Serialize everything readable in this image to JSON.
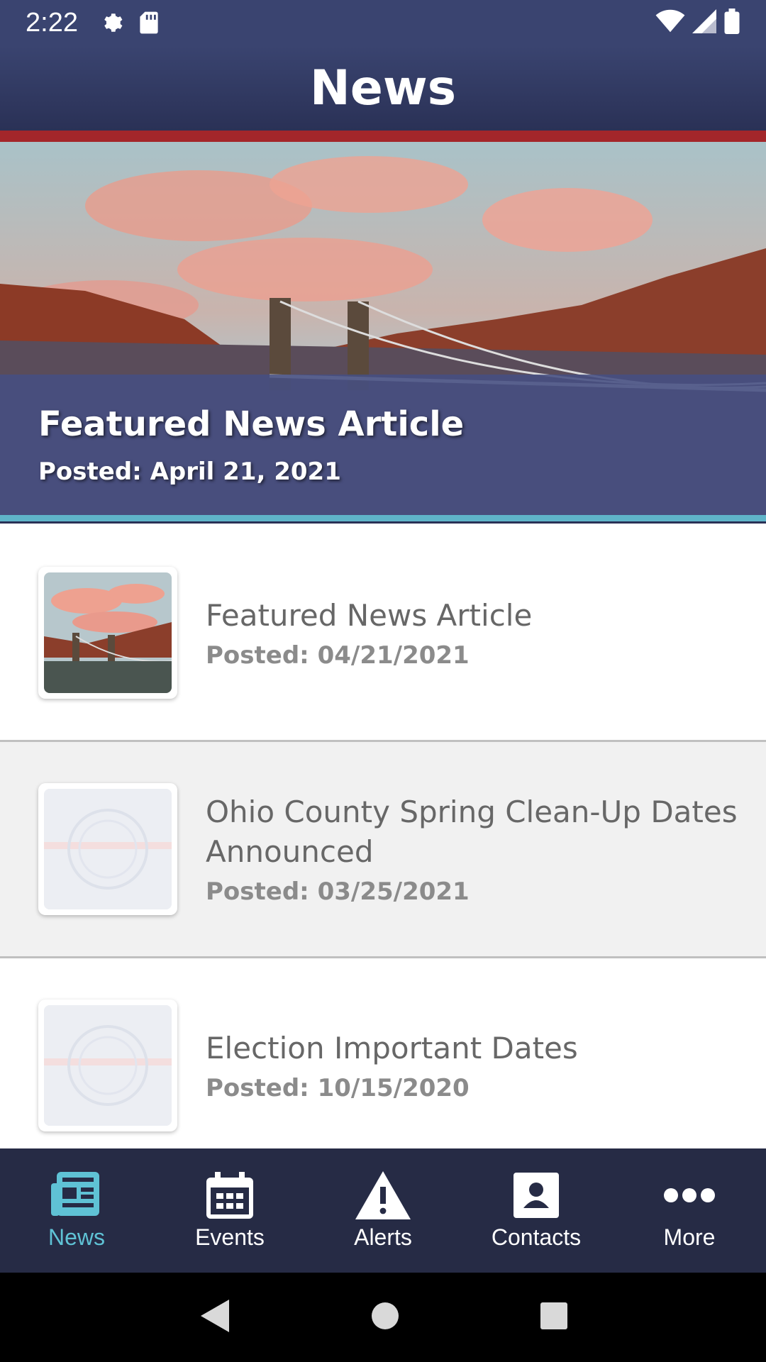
{
  "status_bar": {
    "time": "2:22",
    "icons": [
      "gear-icon",
      "sd-card-icon",
      "wifi-icon",
      "signal-icon",
      "battery-icon"
    ]
  },
  "header": {
    "title": "News"
  },
  "hero": {
    "title": "Featured News Article",
    "date": "Posted: April 21, 2021"
  },
  "news": {
    "items": [
      {
        "title": "Featured News Article",
        "date": "Posted: 04/21/2021",
        "thumbnail": "bridge-photo"
      },
      {
        "title": "Ohio County Spring Clean-Up Dates Announced",
        "date": "Posted: 03/25/2021",
        "thumbnail": "county-seal"
      },
      {
        "title": "Election Important Dates",
        "date": "Posted: 10/15/2020",
        "thumbnail": "county-seal"
      }
    ]
  },
  "bottom_nav": {
    "items": [
      {
        "label": "News",
        "icon": "newspaper-icon",
        "active": true
      },
      {
        "label": "Events",
        "icon": "calendar-icon",
        "active": false
      },
      {
        "label": "Alerts",
        "icon": "warning-icon",
        "active": false
      },
      {
        "label": "Contacts",
        "icon": "contact-icon",
        "active": false
      },
      {
        "label": "More",
        "icon": "more-dots-icon",
        "active": false
      }
    ]
  },
  "colors": {
    "header": "#3a4470",
    "accent_red": "#a3262a",
    "accent_teal": "#5fb4c9",
    "nav_bg": "#262b45",
    "nav_active": "#5fc2d5"
  }
}
